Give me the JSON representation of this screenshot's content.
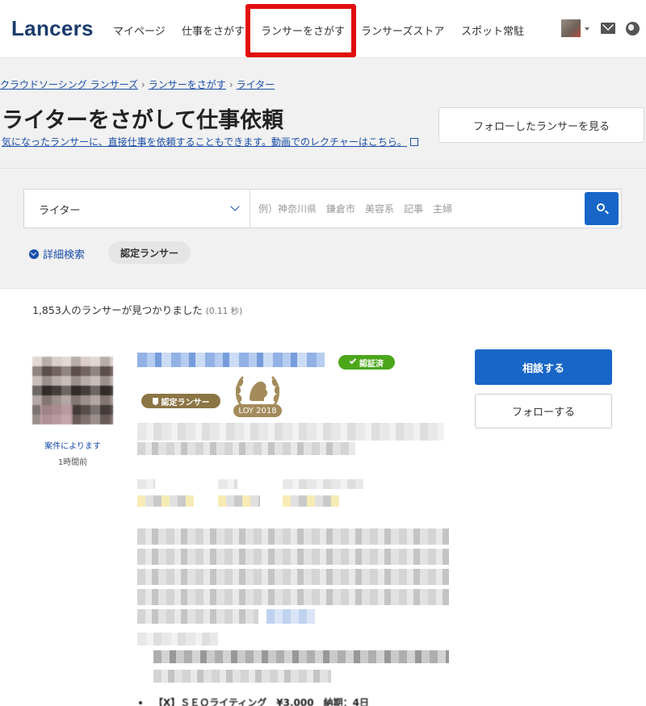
{
  "header": {
    "logo": "Lancers",
    "nav": [
      "マイページ",
      "仕事をさがす",
      "ランサーをさがす",
      "ランサーズストア",
      "スポット常駐"
    ]
  },
  "breadcrumb": [
    "クラウドソーシング ランサーズ",
    "ランサーをさがす",
    "ライター"
  ],
  "hero": {
    "title": "ライターをさがして仕事依頼",
    "subtitle": "気になったランサーに、直接仕事を依頼することもできます。動画でのレクチャーはこちら。",
    "follow_list_button": "フォローしたランサーを見る"
  },
  "search": {
    "category": "ライター",
    "keyword_placeholder": "例）神奈川県　鎌倉市　美容系　記事　主婦",
    "advanced_label": "詳細検索",
    "certified_chip": "認定ランサー"
  },
  "results": {
    "count_text": "1,853人のランサーが見つかりました",
    "time_text": "(0.11 秒)"
  },
  "lancer": {
    "rate": "案件によります",
    "last_login": "1時間前",
    "verified_badge": "認証済",
    "certified_badge": "認定ランサー",
    "loy_label": "LOY 2018",
    "consult_button": "相談する",
    "follow_button": "フォローする",
    "portfolio_item": "【X】ＳＥＯライティング　¥3,000　納期：4日"
  },
  "colors": {
    "accent": "#1766c8",
    "link": "#1a4ea8",
    "highlight": "#e10d0d",
    "verified": "#4ca61a",
    "certified": "#8c7545"
  }
}
